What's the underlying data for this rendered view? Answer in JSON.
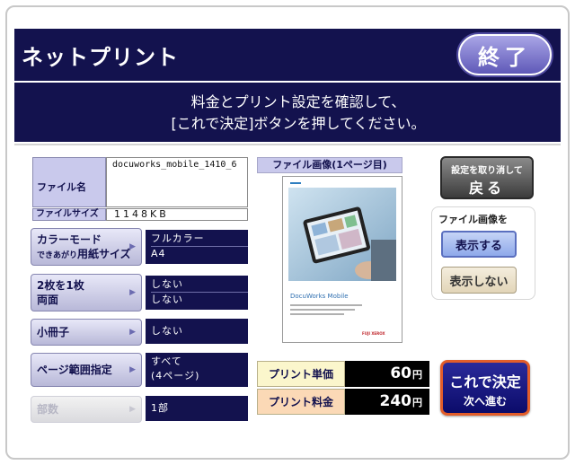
{
  "header": {
    "title": "ネットプリント",
    "exit_label": "終了"
  },
  "banner": {
    "line1": "料金とプリント設定を確認して、",
    "line2": "[これで決定]ボタンを押してください。"
  },
  "file": {
    "name_label": "ファイル名",
    "name_value": "docuworks_mobile_1410_6",
    "size_label": "ファイルサイズ",
    "size_value": "1148KB"
  },
  "settings": {
    "color_mode": {
      "label": "カラーモード",
      "sub_small": "できあがり",
      "sub_bold": "用紙サイズ",
      "value1": "フルカラー",
      "value2": "A4"
    },
    "nup": {
      "label": "2枚を1枚",
      "sub": "両面",
      "value1": "しない",
      "value2": "しない"
    },
    "booklet": {
      "label": "小冊子",
      "value": "しない"
    },
    "page_range": {
      "label": "ページ範囲指定",
      "value1": "すべて",
      "value2": "(4ページ)"
    },
    "copies": {
      "label": "部数",
      "value": "1部"
    }
  },
  "preview": {
    "caption": "ファイル画像(1ページ目)",
    "doc_title": "DocuWorks Mobile",
    "brand": "FUJI XEROX"
  },
  "actions": {
    "cancel_line1": "設定を取り消して",
    "cancel_line2": "戻る",
    "image_toggle_label": "ファイル画像を",
    "show_label": "表示する",
    "hide_label": "表示しない",
    "confirm_line1": "これで決定",
    "confirm_line2": "次へ進む"
  },
  "price": {
    "unit_label": "プリント単価",
    "unit_value": "60",
    "total_label": "プリント料金",
    "total_value": "240",
    "currency": "円"
  },
  "colors": {
    "navy": "#13124e",
    "confirm_border": "#e25d2a"
  }
}
